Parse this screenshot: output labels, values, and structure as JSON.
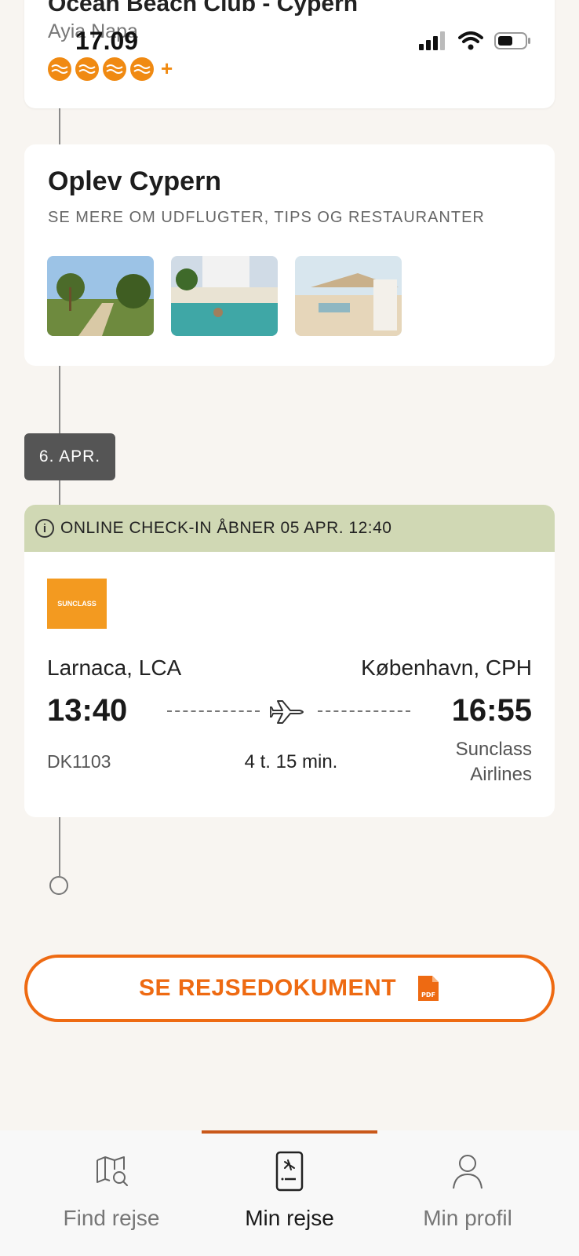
{
  "status_bar": {
    "time": "17.09"
  },
  "hotel": {
    "name": "Ocean Beach Club - Cypern",
    "location": "Ayia Napa",
    "rating_plus": "+"
  },
  "explore": {
    "title": "Oplev Cypern",
    "subtitle": "SE MERE OM UDFLUGTER, TIPS OG RESTAURANTER"
  },
  "date_badge": "6. APR.",
  "flight": {
    "checkin_notice": "ONLINE CHECK-IN ÅBNER 05 APR. 12:40",
    "airline_logo_text": "SUNCLASS",
    "from": "Larnaca, LCA",
    "to": "København, CPH",
    "departure_time": "13:40",
    "arrival_time": "16:55",
    "flight_number": "DK1103",
    "duration": "4 t. 15 min.",
    "carrier": "Sunclass Airlines"
  },
  "document_button": {
    "label": "SE REJSEDOKUMENT",
    "pdf_text": "PDF"
  },
  "nav": {
    "items": [
      {
        "label": "Find rejse",
        "icon": "map-search-icon"
      },
      {
        "label": "Min rejse",
        "icon": "boarding-pass-icon",
        "active": true
      },
      {
        "label": "Min profil",
        "icon": "profile-icon"
      }
    ]
  },
  "colors": {
    "accent": "#ee6a12",
    "rating": "#f08a12",
    "banner": "#d0d8b4",
    "badge": "#555555"
  }
}
